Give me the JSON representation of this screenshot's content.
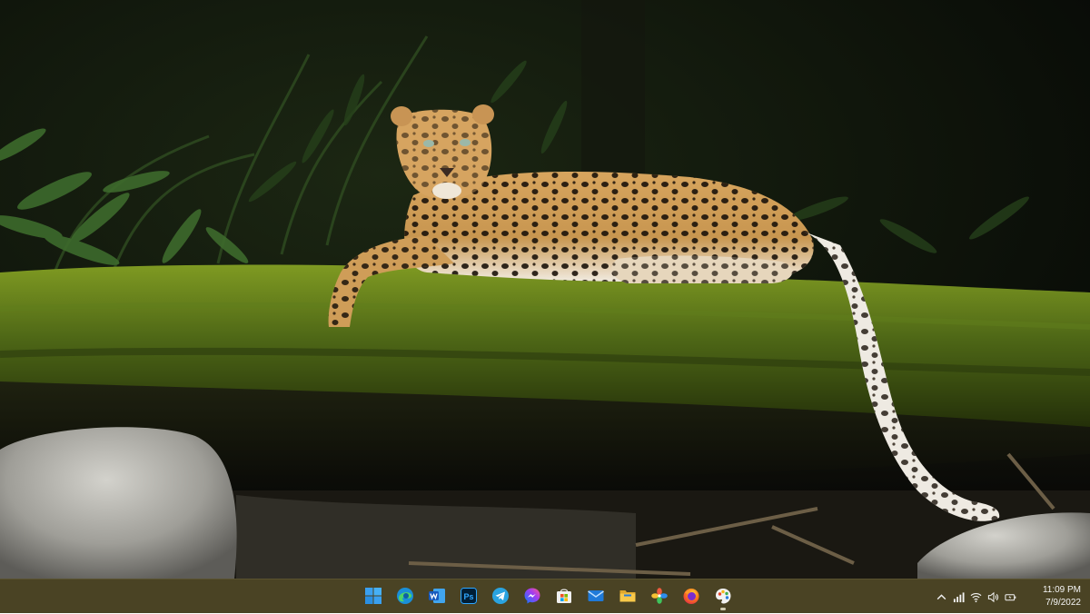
{
  "wallpaper": {
    "description_icon": "leopard-wallpaper"
  },
  "taskbar": {
    "apps": [
      {
        "name": "start-button",
        "icon": "windows-logo-icon",
        "running": false
      },
      {
        "name": "edge-button",
        "icon": "edge-icon",
        "running": false
      },
      {
        "name": "word-button",
        "icon": "word-icon",
        "running": false
      },
      {
        "name": "photoshop-button",
        "icon": "photoshop-icon",
        "running": false
      },
      {
        "name": "telegram-button",
        "icon": "telegram-icon",
        "running": false
      },
      {
        "name": "messenger-button",
        "icon": "messenger-icon",
        "running": false
      },
      {
        "name": "store-button",
        "icon": "store-icon",
        "running": false
      },
      {
        "name": "mail-button",
        "icon": "mail-icon",
        "running": false
      },
      {
        "name": "file-explorer-button",
        "icon": "folder-icon",
        "running": false
      },
      {
        "name": "photos-button",
        "icon": "photos-icon",
        "running": false
      },
      {
        "name": "firefox-button",
        "icon": "firefox-icon",
        "running": false
      },
      {
        "name": "paint-button",
        "icon": "paint-icon",
        "running": true
      }
    ],
    "tray": {
      "chevron_icon": "chevron-up-icon",
      "icons": [
        "network-bars-icon",
        "wifi-icon",
        "volume-icon",
        "battery-icon"
      ],
      "time": "11:09 PM",
      "date": "7/9/2022"
    },
    "colors": {
      "taskbar_bg": "#4a4324",
      "text": "#f5f5f5"
    }
  }
}
